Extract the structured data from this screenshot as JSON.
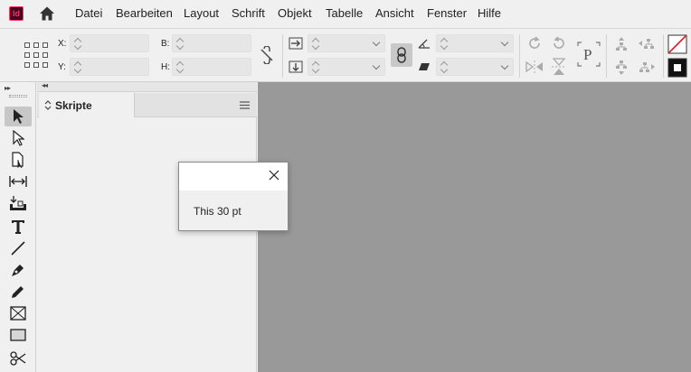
{
  "app": {
    "logo_text": "Id"
  },
  "menu": [
    "Datei",
    "Bearbeiten",
    "Layout",
    "Schrift",
    "Objekt",
    "Tabelle",
    "Ansicht",
    "Fenster",
    "Hilfe"
  ],
  "control": {
    "x_label": "X:",
    "y_label": "Y:",
    "w_label": "B:",
    "h_label": "H:",
    "x_value": "",
    "y_value": "",
    "w_value": "",
    "h_value": "",
    "scale_x_value": "",
    "scale_y_value": "",
    "rotate_value": "",
    "shear_value": "",
    "text_frame_icon": "P"
  },
  "tools": [
    "selection-tool",
    "direct-selection-tool",
    "page-tool",
    "gap-tool",
    "content-collector-tool",
    "type-tool",
    "line-tool",
    "pen-tool",
    "pencil-tool",
    "rectangle-frame-tool",
    "rectangle-tool",
    "scissors-tool"
  ],
  "panel": {
    "tab_label": "Skripte",
    "collapse_left": "▸▸",
    "collapse_right": "◂◂"
  },
  "dialog": {
    "message": "This 30 pt"
  },
  "colors": {
    "canvas": "#999999",
    "accent": "#ff3366",
    "logo_bg": "#49021f"
  }
}
